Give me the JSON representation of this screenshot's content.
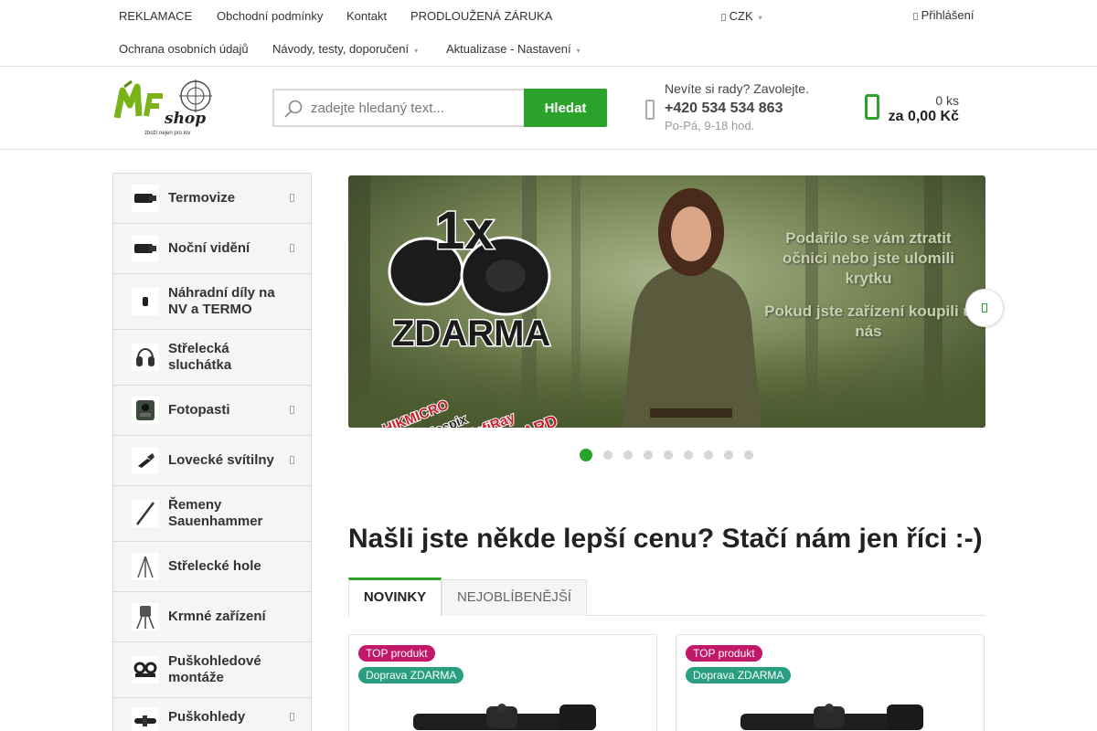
{
  "topnav": {
    "row1": [
      "REKLAMACE",
      "Obchodní podmínky",
      "Kontakt",
      "PRODLOUŽENÁ ZÁRUKA"
    ],
    "row2": [
      "Ochrana osobních údajů",
      "Návody, testy, doporučení",
      "Aktualizase - Nastavení"
    ],
    "currency": "CZK",
    "login": "Přihlášení"
  },
  "header": {
    "logo_text": "MF shop",
    "logo_tagline": "zboží nejen pro lov",
    "search_placeholder": "zadejte hledaný text...",
    "search_button": "Hledat",
    "help_text": "Nevíte si rady? Zavolejte.",
    "phone": "+420 534 534 863",
    "hours": "Po-Pá, 9-18 hod.",
    "cart_count": "0 ks",
    "cart_total": "za 0,00 Kč"
  },
  "sidebar": {
    "items": [
      {
        "label": "Termovize",
        "icon": "thermal-camera-icon",
        "submenu": true
      },
      {
        "label": "Noční vidění",
        "icon": "night-vision-icon",
        "submenu": true
      },
      {
        "label": "Náhradní díly na NV a TERMO",
        "icon": "spare-part-icon",
        "submenu": false
      },
      {
        "label": "Střelecká sluchátka",
        "icon": "earmuffs-icon",
        "submenu": false
      },
      {
        "label": "Fotopasti",
        "icon": "trail-camera-icon",
        "submenu": true
      },
      {
        "label": "Lovecké svítilny",
        "icon": "flashlight-icon",
        "submenu": true
      },
      {
        "label": "Řemeny Sauenhammer",
        "icon": "strap-icon",
        "submenu": false
      },
      {
        "label": "Střelecké hole",
        "icon": "shooting-stick-icon",
        "submenu": false
      },
      {
        "label": "Krmné zařízení",
        "icon": "feeder-icon",
        "submenu": false
      },
      {
        "label": "Puškohledové montáže",
        "icon": "scope-mount-icon",
        "submenu": false
      },
      {
        "label": "Puškohledy",
        "icon": "rifle-scope-icon",
        "submenu": true
      }
    ]
  },
  "banner": {
    "big_text": "1x",
    "free_text": "ZDARMA",
    "line1": "Podařilo se vám ztratit očnici nebo jste ulomili krytku",
    "line2": "Pokud jste zařízení koupili u nás",
    "brands": [
      "HIKMICRO",
      "Nocpix",
      "InfiRay",
      "PARD"
    ],
    "slide_count": 9,
    "active_slide": 0
  },
  "headline": "Našli jste někde lepší cenu? Stačí nám jen říci :-)",
  "tabs": [
    "NOVINKY",
    "NEJOBLÍBENĚJŠÍ"
  ],
  "products": [
    {
      "badges": [
        "TOP produkt",
        "Doprava ZDARMA"
      ]
    },
    {
      "badges": [
        "TOP produkt",
        "Doprava ZDARMA"
      ]
    }
  ],
  "colors": {
    "accent_green": "#29a329",
    "badge_top": "#c1186a",
    "badge_shipping": "#2a9e80"
  }
}
